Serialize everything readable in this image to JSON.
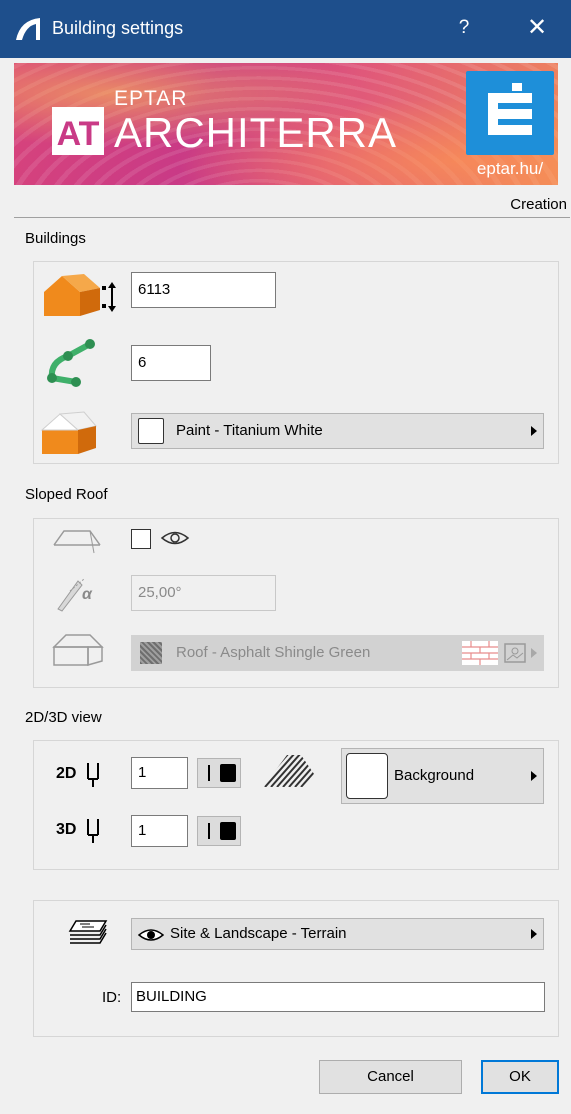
{
  "window": {
    "title": "Building settings",
    "help_icon": "?",
    "close_icon": "✕",
    "accent": "#1e4f8c"
  },
  "banner": {
    "brand_small": "EPTAR",
    "brand_large": "ARCHITERRA",
    "logo_text": "AT",
    "url": "eptar.hu/"
  },
  "tab_label": "Creation",
  "buildings": {
    "section_label": "Buildings",
    "height_value": "6113",
    "segments_value": "6",
    "surface_label": "Paint - Titanium White"
  },
  "sloped_roof": {
    "section_label": "Sloped Roof",
    "enabled": false,
    "angle_value": "25,00°",
    "surface_label": "Roof - Asphalt Shingle Green"
  },
  "view": {
    "section_label": "2D/3D view",
    "pen_2d_label": "2D",
    "pen_2d_value": "1",
    "pen_3d_label": "3D",
    "pen_3d_value": "1",
    "fill_label": "Background"
  },
  "layer": {
    "label": "Site & Landscape - Terrain",
    "id_label": "ID:",
    "id_value": "BUILDING"
  },
  "buttons": {
    "cancel": "Cancel",
    "ok": "OK"
  }
}
